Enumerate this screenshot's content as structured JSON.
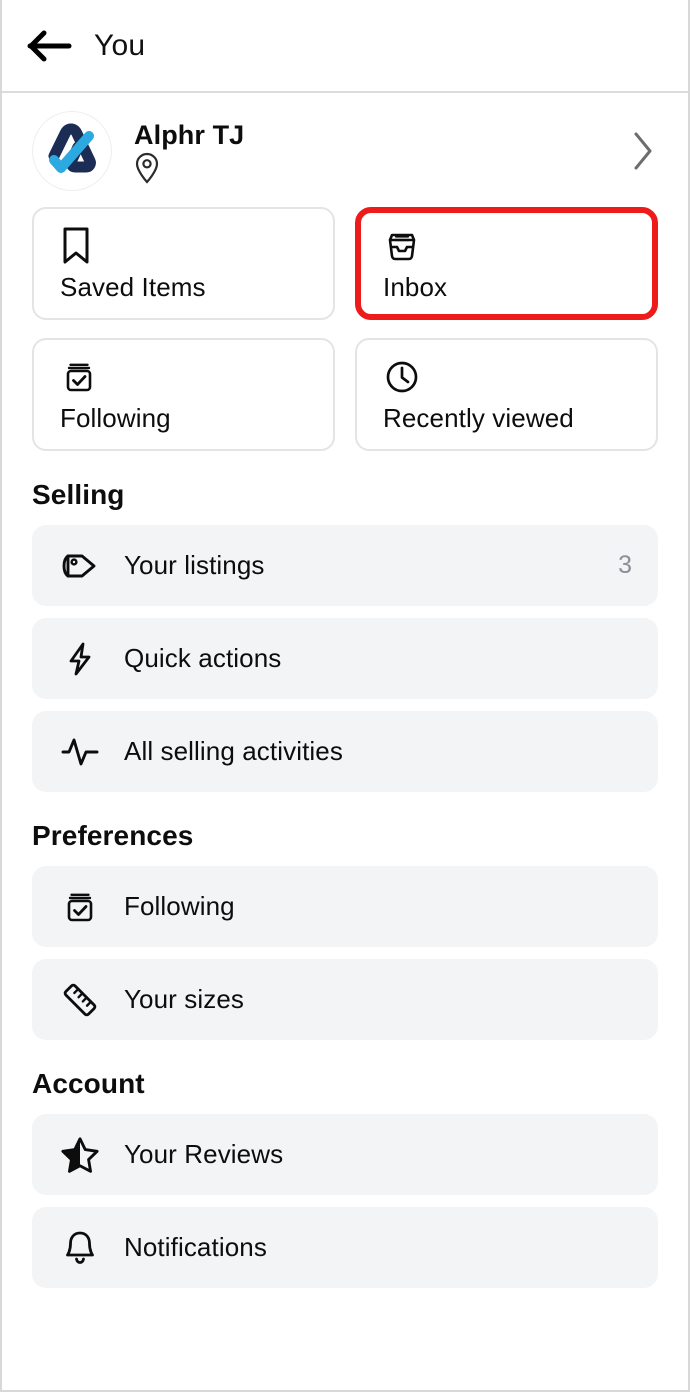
{
  "header": {
    "back_icon": "arrow-left-icon",
    "title": "You"
  },
  "profile": {
    "name": "Alphr TJ",
    "location_icon": "map-pin-icon",
    "avatar_icon": "alphr-logo-avatar",
    "chevron_icon": "chevron-right-icon",
    "colors": {
      "logo_dark": "#1b2d55",
      "logo_light": "#2ca9e0"
    }
  },
  "quick_cards": [
    {
      "label": "Saved Items",
      "icon": "bookmark-icon",
      "highlighted": false
    },
    {
      "label": "Inbox",
      "icon": "inbox-icon",
      "highlighted": true
    },
    {
      "label": "Following",
      "icon": "archive-check-icon",
      "highlighted": false
    },
    {
      "label": "Recently viewed",
      "icon": "clock-icon",
      "highlighted": false
    }
  ],
  "highlight_color": "#ee1b1b",
  "sections": [
    {
      "title": "Selling",
      "items": [
        {
          "label": "Your listings",
          "icon": "price-tag-icon",
          "count": "3"
        },
        {
          "label": "Quick actions",
          "icon": "lightning-bolt-icon",
          "count": ""
        },
        {
          "label": "All selling activities",
          "icon": "activity-pulse-icon",
          "count": ""
        }
      ]
    },
    {
      "title": "Preferences",
      "items": [
        {
          "label": "Following",
          "icon": "archive-check-icon",
          "count": ""
        },
        {
          "label": "Your sizes",
          "icon": "ruler-icon",
          "count": ""
        }
      ]
    },
    {
      "title": "Account",
      "items": [
        {
          "label": "Your Reviews",
          "icon": "half-star-icon",
          "count": ""
        },
        {
          "label": "Notifications",
          "icon": "bell-icon",
          "count": ""
        }
      ]
    }
  ]
}
